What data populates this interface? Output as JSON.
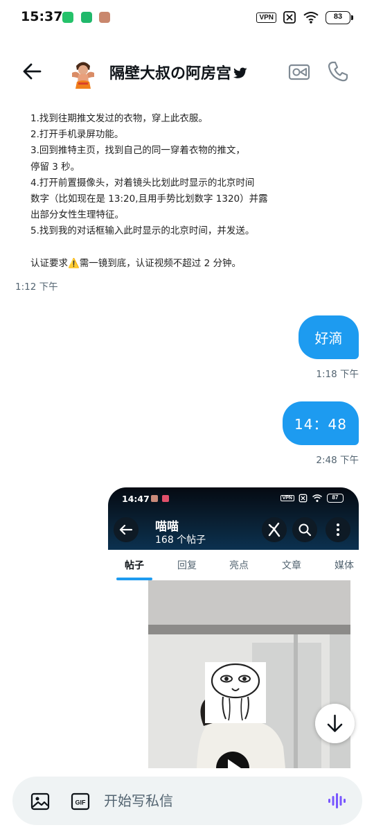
{
  "status_bar": {
    "time": "15:37",
    "vpn": "VPN",
    "battery": "83"
  },
  "header": {
    "contact_name": "隔壁大叔の阿房宫",
    "icons": [
      "back-arrow-icon",
      "avatar",
      "bird-icon",
      "video-call-icon",
      "phone-icon"
    ]
  },
  "received": {
    "lines": [
      "1.找到往期推文发过的衣物，穿上此衣服。",
      "2.打开手机录屏功能。",
      "3.回到推特主页，找到自己的同一穿着衣物的推文，",
      "停留 3 秒。",
      "4.打开前置摄像头，对着镜头比划此时显示的北京时间",
      "数字（比如现在是 13:20,且用手势比划数字 1320）并露",
      "出部分女性生理特征。",
      "5.找到我的对话框输入此时显示的北京时间，并发送。",
      "",
      "认证要求⚠️需一镜到底，认证视频不超过 2 分钟。"
    ],
    "time": "1:12 下午"
  },
  "sent": [
    {
      "text": "好滴",
      "time": "1:18 下午"
    },
    {
      "text": "14：48",
      "time": "2:48 下午"
    }
  ],
  "shared_screenshot": {
    "status_time": "14:47",
    "status_vpn": "VPN",
    "status_battery": "87",
    "profile_name": "喵喵",
    "post_count": "168 个帖子",
    "tabs": [
      "帖子",
      "回复",
      "亮点",
      "文章",
      "媒体"
    ],
    "active_tab": "帖子"
  },
  "composer": {
    "placeholder": "开始写私信"
  },
  "colors": {
    "accent": "#1d9bf0",
    "voice": "#7856ff",
    "time_gray": "#536471"
  }
}
